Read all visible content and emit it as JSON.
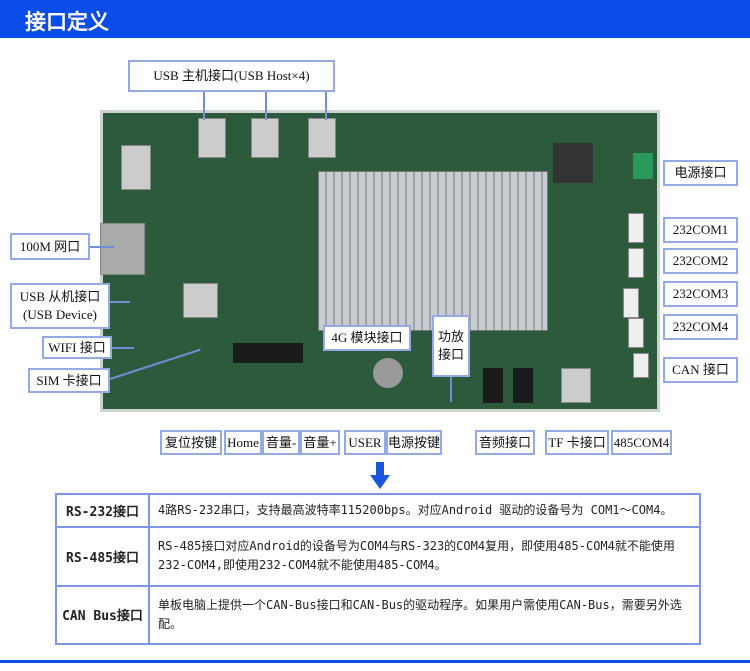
{
  "header": {
    "title": "接口定义"
  },
  "labels": {
    "usb_host": "USB 主机接口(USB Host×4)",
    "lan": "100M 网口",
    "usb_device_1": "USB 从机接口",
    "usb_device_2": "(USB Device)",
    "wifi": "WIFI 接口",
    "sim": "SIM 卡接口",
    "module_4g": "4G 模块接口",
    "amp_1": "功放",
    "amp_2": "接口",
    "power": "电源接口",
    "com1": "232COM1",
    "com2": "232COM2",
    "com3": "232COM3",
    "com4": "232COM4",
    "can": "CAN 接口",
    "reset": "复位按键",
    "home": "Home",
    "vol_down": "音量-",
    "vol_up": "音量+",
    "user": "USER",
    "power_btn": "电源按键",
    "audio": "音频接口",
    "tf": "TF 卡接口",
    "com485": "485COM4"
  },
  "table": [
    {
      "name": "RS-232接口",
      "desc": "4路RS-232串口，支持最高波特率115200bps。对应Android 驱动的设备号为 COM1～COM4。"
    },
    {
      "name": "RS-485接口",
      "desc": "RS-485接口对应Android的设备号为COM4与RS-323的COM4复用，即使用485-COM4就不能使用232-COM4,即使用232-COM4就不能使用485-COM4。"
    },
    {
      "name": "CAN Bus接口",
      "desc": "单板电脑上提供一个CAN-Bus接口和CAN-Bus的驱动程序。如果用户需使用CAN-Bus，需要另外选配。"
    }
  ],
  "colors": {
    "accent": "#0a4de8",
    "border": "#93aae6"
  }
}
